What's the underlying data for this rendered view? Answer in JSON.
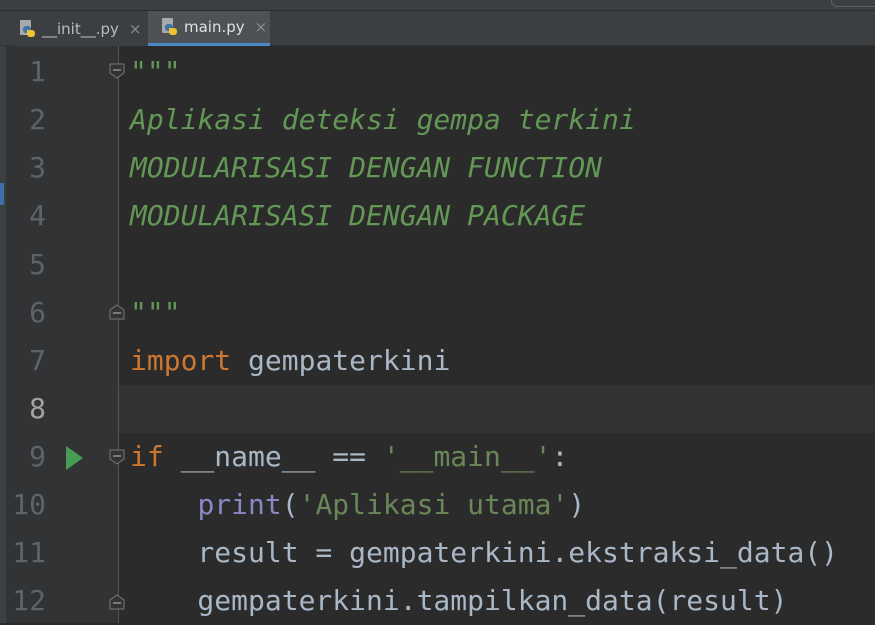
{
  "tabs": [
    {
      "label": "__init__.py",
      "close_icon": "×",
      "active": false
    },
    {
      "label": "main.py",
      "close_icon": "×",
      "active": true
    }
  ],
  "line_numbers": [
    "1",
    "2",
    "3",
    "4",
    "5",
    "6",
    "7",
    "8",
    "9",
    "10",
    "11",
    "12"
  ],
  "code": {
    "l1": "\"\"\"",
    "l2": "Aplikasi deteksi gempa terkini",
    "l3": "MODULARISASI DENGAN FUNCTION",
    "l4": "MODULARISASI DENGAN PACKAGE",
    "l6": "\"\"\"",
    "l7_kw": "import",
    "l7_rest": " gempaterkini",
    "l9_kw": "if",
    "l9_mid": " __name__ == ",
    "l9_str": "'__main__'",
    "l9_end": ":",
    "l10_indent": "    ",
    "l10_builtin": "print",
    "l10_open": "(",
    "l10_str": "'Aplikasi utama'",
    "l10_close": ")",
    "l11": "    result = gempaterkini.ekstraksi_data()",
    "l12": "    gempaterkini.tampilkan_data(result)"
  },
  "colors": {
    "background": "#2b2b2b",
    "keyword": "#cc7832",
    "docstring": "#629755",
    "string": "#6a8759",
    "builtin": "#8888c6",
    "text": "#a9b7c6",
    "run": "#499c54"
  },
  "icons": {
    "file_icon": "python-file-icon",
    "run_icon": "run-gutter-icon",
    "fold_icon": "fold-marker-icon"
  }
}
